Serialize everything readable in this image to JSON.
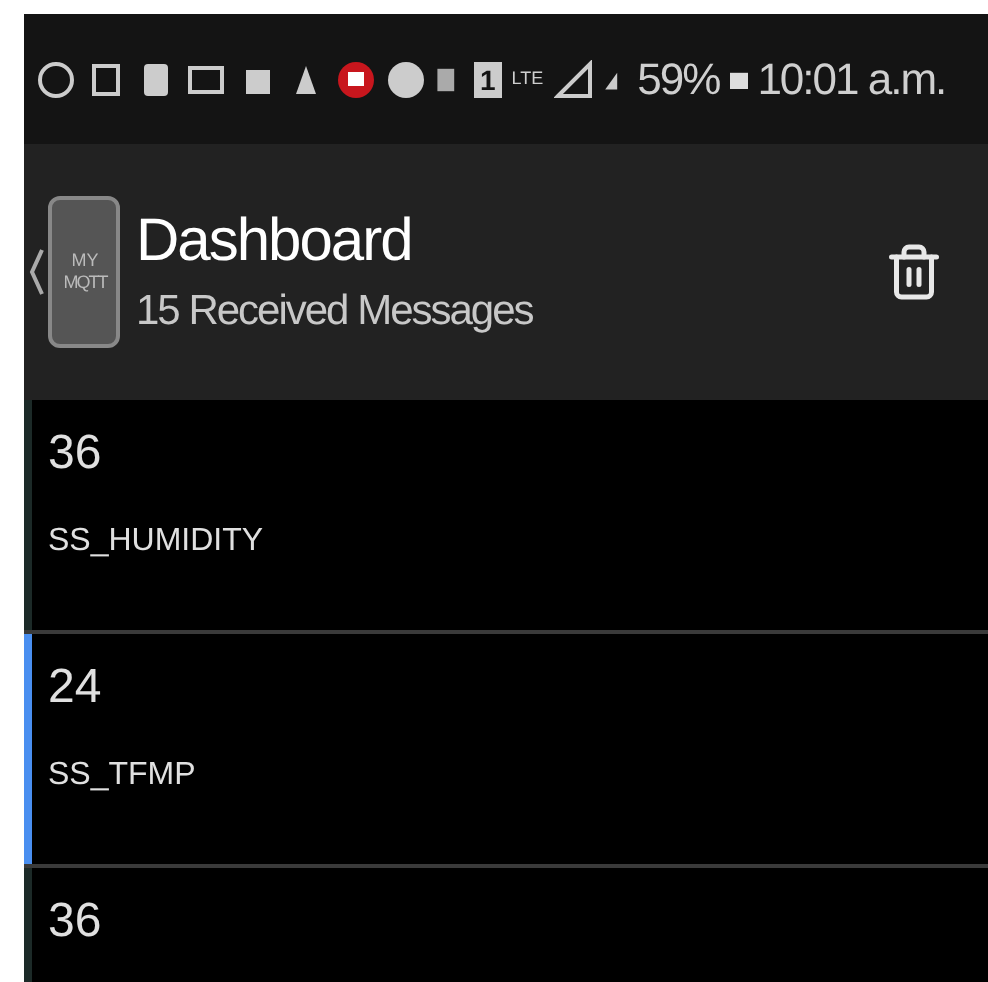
{
  "status_bar": {
    "sim_label": "1",
    "network_label": "LTE",
    "battery": "59%",
    "time": "10:01 a.m."
  },
  "header": {
    "logo_top": "MY",
    "logo_bottom": "MQTT",
    "title": "Dashboard",
    "subtitle": "15 Received Messages"
  },
  "messages": [
    {
      "value": "36",
      "topic": "SS_HUMIDITY",
      "selected": false
    },
    {
      "value": "24",
      "topic": "SS_TFMP",
      "selected": true
    },
    {
      "value": "36",
      "selected": false
    }
  ]
}
